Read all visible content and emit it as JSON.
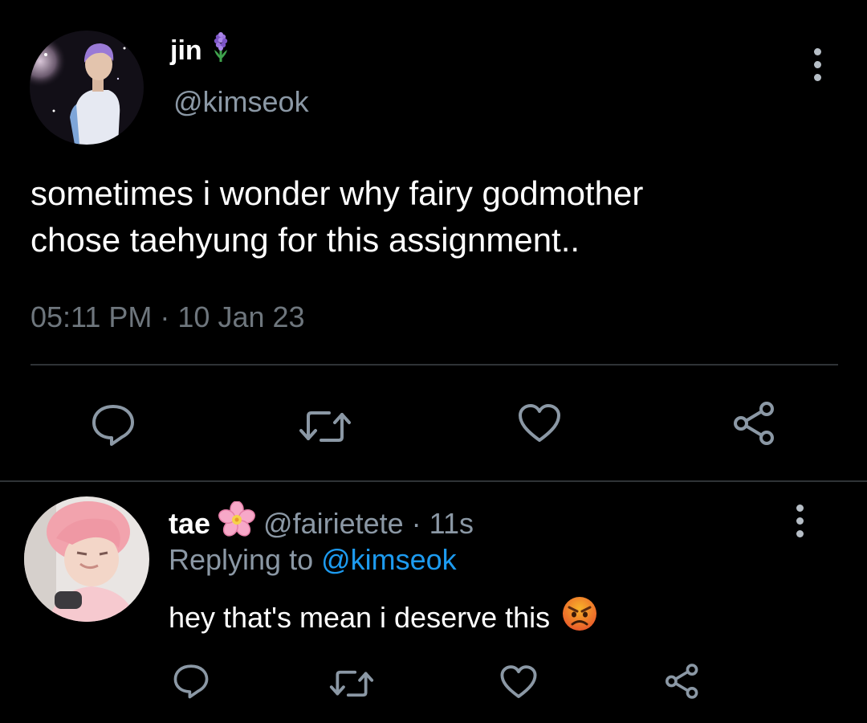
{
  "colors": {
    "background": "#000000",
    "text_primary": "#ffffff",
    "text_secondary": "#8b98a5",
    "text_muted": "#6e767d",
    "link": "#1d9bf0",
    "divider": "#2f3336",
    "icon": "#8b98a5"
  },
  "main_tweet": {
    "avatar_icon": "user-photo-avatar",
    "display_name": "jin",
    "name_emoji_icon": "hyacinth-flower-icon",
    "handle": "@kimseok",
    "menu_icon": "more-vertical-icon",
    "text_line1": "sometimes i wonder why fairy godmother",
    "text_line2": "chose taehyung for this assignment..",
    "timestamp": "05:11 PM · 10 Jan 23",
    "actions": [
      {
        "name": "reply",
        "icon": "reply-bubble-icon"
      },
      {
        "name": "retweet",
        "icon": "retweet-icon"
      },
      {
        "name": "like",
        "icon": "heart-icon"
      },
      {
        "name": "share",
        "icon": "share-icon"
      }
    ]
  },
  "reply_tweet": {
    "avatar_icon": "user-photo-avatar",
    "display_name": "tae",
    "name_emoji_icon": "cherry-blossom-icon",
    "handle_time": "@fairietete · 11s",
    "replying_prefix": "Replying to ",
    "replying_handle": "@kimseok",
    "menu_icon": "more-vertical-icon",
    "text": "hey that's mean i deserve this",
    "text_emoji_icon": "angry-face-icon",
    "actions": [
      {
        "name": "reply",
        "icon": "reply-bubble-icon"
      },
      {
        "name": "retweet",
        "icon": "retweet-icon"
      },
      {
        "name": "like",
        "icon": "heart-icon"
      },
      {
        "name": "share",
        "icon": "share-icon"
      }
    ]
  }
}
